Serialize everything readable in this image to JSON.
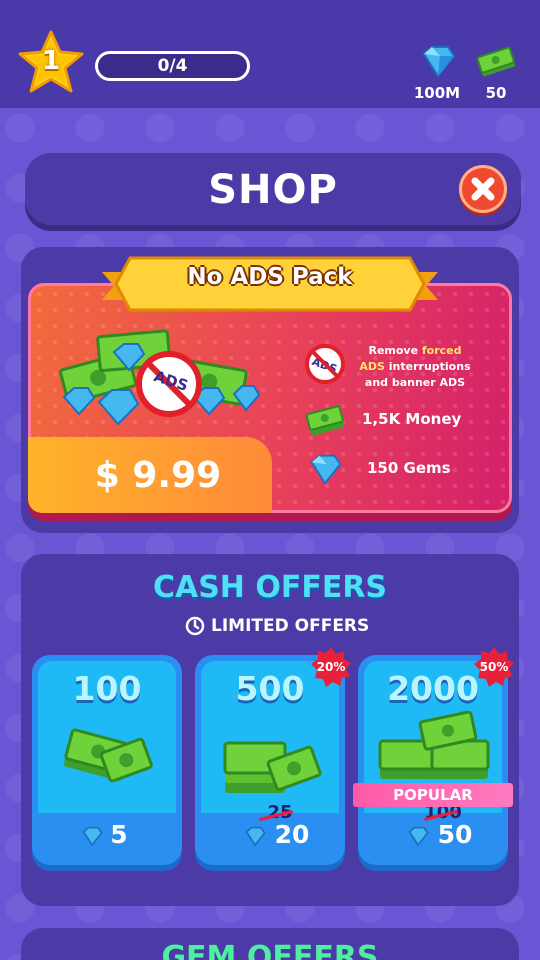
{
  "topbar": {
    "level": "1",
    "progress": "0/4",
    "gems": "100M",
    "money": "50"
  },
  "header": {
    "title": "SHOP"
  },
  "no_ads_pack": {
    "title": "No ADS Pack",
    "price": "$ 9.99",
    "feature_remove_pre": "Remove ",
    "feature_remove_hl1": "forced",
    "feature_remove_hl2": "ADS",
    "feature_remove_mid": " interruptions",
    "feature_remove_post": "and banner ADS",
    "feature_money": "1,5K Money",
    "feature_gems": "150 Gems",
    "badge_text": "ADS"
  },
  "cash_offers": {
    "title": "CASH OFFERS",
    "subtitle": "LIMITED OFFERS",
    "popular_label": "POPULAR",
    "items": [
      {
        "amount": "100",
        "price": "5",
        "old_price": "",
        "discount": ""
      },
      {
        "amount": "500",
        "price": "20",
        "old_price": "25",
        "discount": "20%"
      },
      {
        "amount": "2000",
        "price": "50",
        "old_price": "100",
        "discount": "50%"
      }
    ]
  },
  "gem_offers": {
    "title": "GEM OFFERS"
  },
  "colors": {
    "background": "#6a55d4",
    "panel": "#4c3aa6",
    "accent_cyan": "#4ee0f4",
    "close_red": "#ef4a30",
    "price_orange": "#ffb42a"
  }
}
